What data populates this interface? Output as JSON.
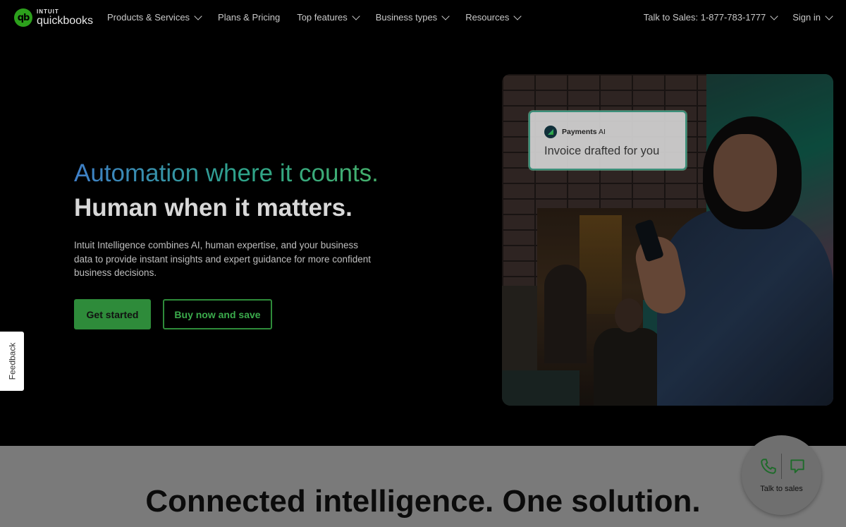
{
  "brand": {
    "top": "INTUIT",
    "bottom": "quickbooks",
    "mark": "qb"
  },
  "nav": {
    "links": [
      {
        "label": "Products & Services",
        "dropdown": true
      },
      {
        "label": "Plans & Pricing",
        "dropdown": false
      },
      {
        "label": "Top features",
        "dropdown": true
      },
      {
        "label": "Business types",
        "dropdown": true
      },
      {
        "label": "Resources",
        "dropdown": true
      }
    ],
    "talk_to_sales": "Talk to Sales: 1-877-783-1777",
    "sign_in": "Sign in"
  },
  "hero": {
    "headline_1": "Automation where it counts.",
    "headline_2": "Human when it matters.",
    "body": "Intuit Intelligence combines AI, human expertise, and your business data to provide instant insights and expert guidance for more confident business decisions.",
    "primary_cta": "Get started",
    "secondary_cta": "Buy now and save",
    "card": {
      "product": "Payments",
      "product_suffix": "AI",
      "message": "Invoice drafted for you"
    }
  },
  "feedback": "Feedback",
  "section": {
    "title": "Connected intelligence. One solution."
  },
  "sales_widget": {
    "label": "Talk to sales",
    "icons": [
      "phone-icon",
      "chat-icon"
    ]
  },
  "colors": {
    "accent": "#2ca01c",
    "button_green": "#2e8b3a",
    "gradient_start": "#3f7fc8",
    "gradient_end": "#45b06b"
  }
}
